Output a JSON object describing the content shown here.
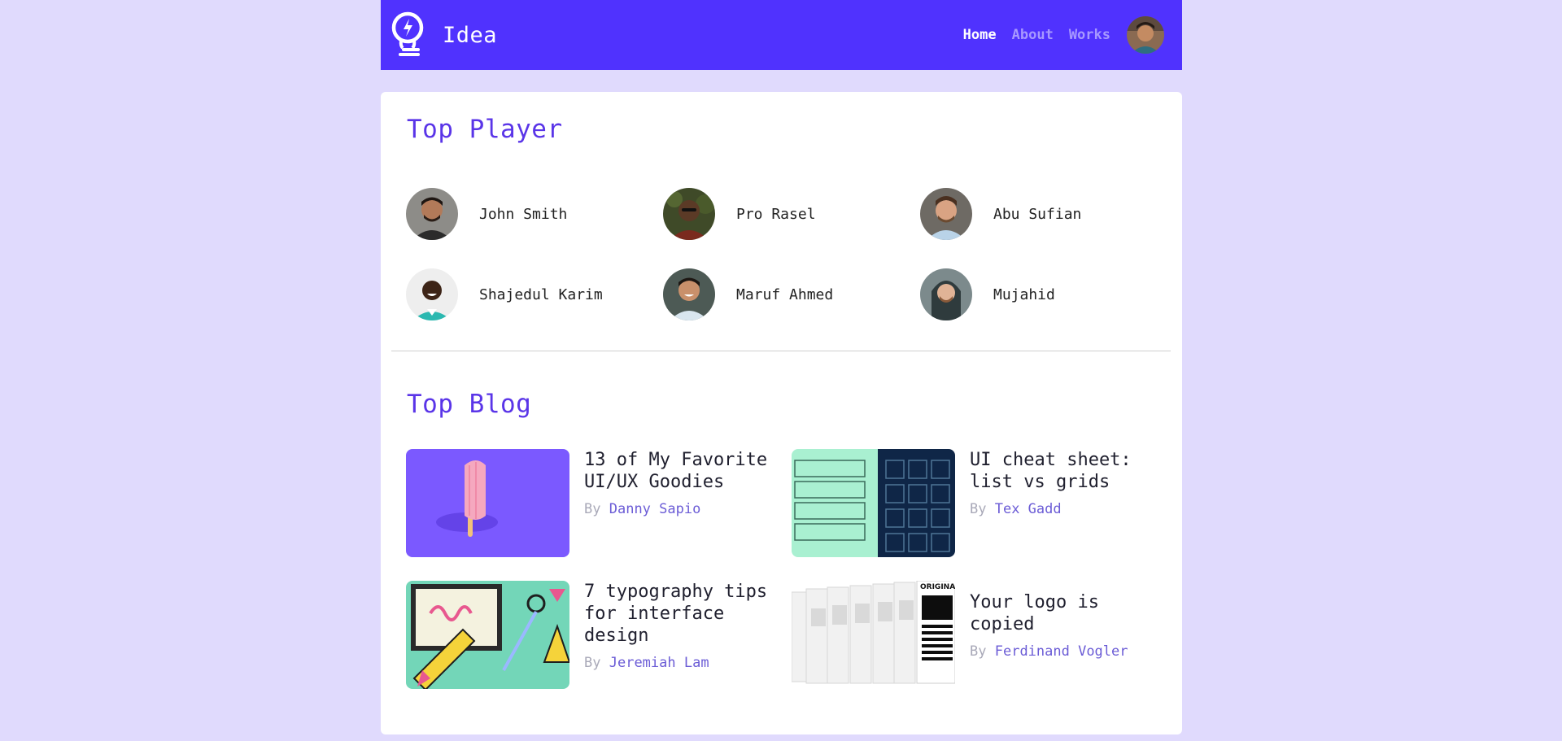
{
  "header": {
    "brand": "Idea",
    "nav": [
      {
        "label": "Home",
        "active": true
      },
      {
        "label": "About",
        "active": false
      },
      {
        "label": "Works",
        "active": false
      }
    ],
    "colors": {
      "bar": "#5032fe",
      "background": "#e0dafd",
      "accent": "#5a35e8"
    }
  },
  "players": {
    "title": "Top Player",
    "items": [
      {
        "name": "John Smith"
      },
      {
        "name": "Pro Rasel"
      },
      {
        "name": "Abu Sufian"
      },
      {
        "name": "Shajedul Karim"
      },
      {
        "name": "Maruf Ahmed"
      },
      {
        "name": "Mujahid"
      }
    ]
  },
  "blogs": {
    "title": "Top Blog",
    "by_label": "By",
    "items": [
      {
        "title": "13 of My Favorite UI/UX Goodies",
        "author": "Danny Sapio"
      },
      {
        "title": "UI cheat sheet: list vs grids",
        "author": "Tex Gadd"
      },
      {
        "title": "7 typography tips for interface design",
        "author": "Jeremiah Lam"
      },
      {
        "title": "Your logo is copied",
        "author": "Ferdinand Vogler",
        "thumb_text": "ORIGINA"
      }
    ]
  }
}
